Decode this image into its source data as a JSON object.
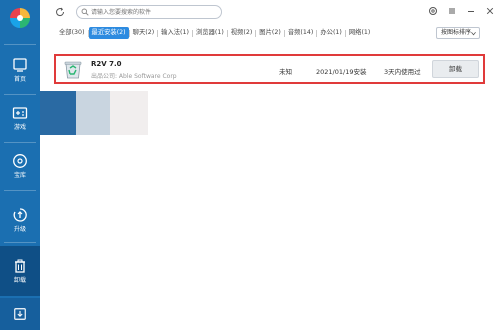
{
  "sidebar": {
    "items": [
      {
        "label": "首页",
        "icon": "home-icon"
      },
      {
        "label": "游戏",
        "icon": "gamepad-icon"
      },
      {
        "label": "宝库",
        "icon": "disc-icon"
      },
      {
        "label": "升级",
        "icon": "upgrade-icon"
      },
      {
        "label": "卸载",
        "icon": "trash-icon"
      }
    ],
    "bottom_icon": "download-icon"
  },
  "search": {
    "placeholder": "请输入您要搜索的软件"
  },
  "tabs": [
    {
      "label": "全部(30)"
    },
    {
      "label": "最近安装(2)"
    },
    {
      "label": "聊天(2)"
    },
    {
      "label": "输入法(1)"
    },
    {
      "label": "浏览器(1)"
    },
    {
      "label": "视频(2)"
    },
    {
      "label": "图片(2)"
    },
    {
      "label": "音频(14)"
    },
    {
      "label": "办公(1)"
    },
    {
      "label": "网络(1)"
    }
  ],
  "sort_label": "按图标排序",
  "app": {
    "name": "R2V 7.0",
    "publisher": "出品公司: Able Software Corp",
    "size": "未知",
    "install_date": "2021/01/19安装",
    "last_used": "3天内使用过",
    "uninstall_label": "卸载"
  },
  "colors": {
    "sidebar": "#1b6fb1",
    "active_tab": "#2d8be0",
    "highlight": "#e03a3a"
  }
}
